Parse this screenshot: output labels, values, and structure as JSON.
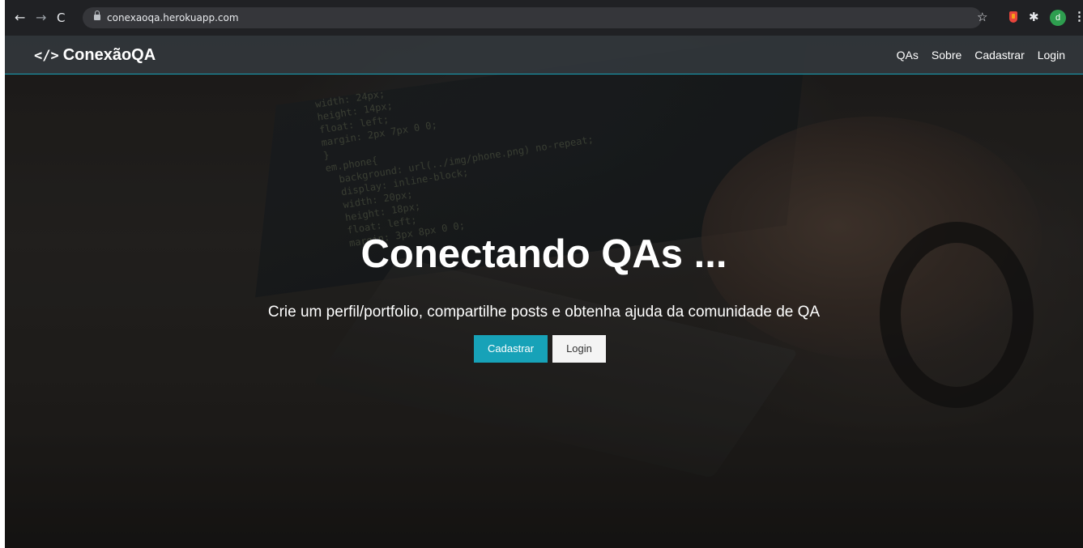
{
  "browser": {
    "back_glyph": "←",
    "forward_glyph": "→",
    "reload_glyph": "C",
    "url": "conexaoqa.herokuapp.com",
    "star_glyph": "☆",
    "puzzle_glyph": "✱",
    "profile_initial": "d",
    "menu_glyph": "⋮",
    "icons": [
      "back-arrow-icon",
      "forward-arrow-icon",
      "reload-icon",
      "lock-icon",
      "bookmark-star-icon",
      "extension-icon",
      "puzzle-icon",
      "profile-avatar",
      "kebab-menu-icon"
    ]
  },
  "navbar": {
    "brand_icon": "</>",
    "brand_text": "ConexãoQA",
    "links": [
      {
        "label": "QAs"
      },
      {
        "label": "Sobre"
      },
      {
        "label": "Cadastrar"
      },
      {
        "label": "Login"
      }
    ]
  },
  "hero": {
    "title": "Conectando QAs ...",
    "subtitle": "Crie um perfil/portfolio, compartilhe posts e obtenha ajuda da comunidade de QA",
    "primary_button": "Cadastrar",
    "secondary_button": "Login"
  },
  "colors": {
    "accent": "#17a2b8",
    "navbar_bg": "#343a40",
    "browser_chrome": "#202124"
  }
}
